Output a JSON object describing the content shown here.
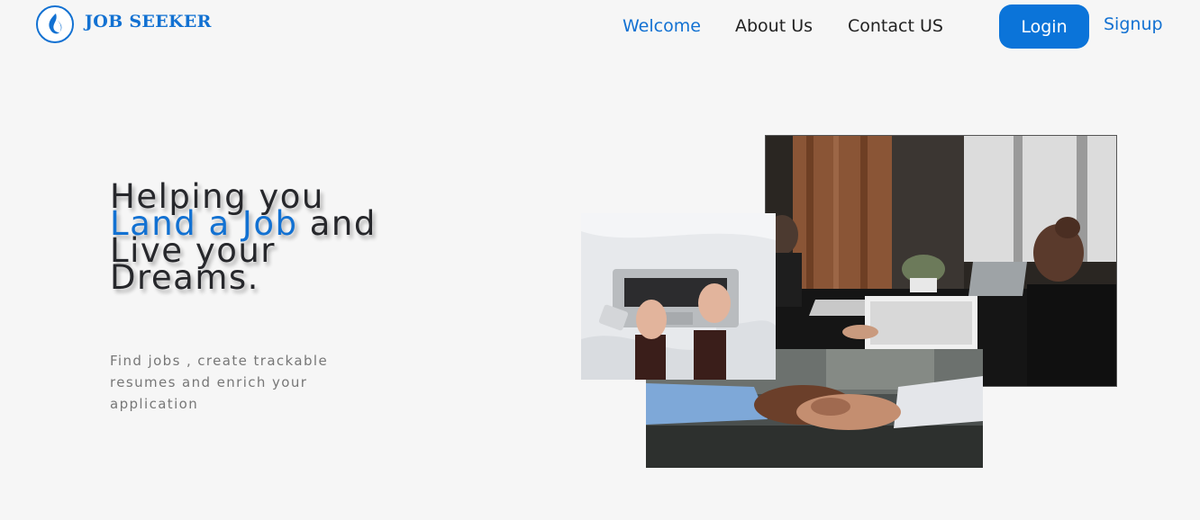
{
  "brand": {
    "name": "JOB SEEKER",
    "logo_icon": "flame-drop-icon",
    "color": "#1271d2"
  },
  "nav": {
    "welcome": "Welcome",
    "about": "About Us",
    "contact": "Contact US",
    "active": "Welcome"
  },
  "auth": {
    "login": "Login",
    "signup": "Signup",
    "login_bg": "#0b74d9"
  },
  "hero": {
    "title_line1": "Helping you",
    "title_accent": "Land a Job",
    "title_line2_rest": " and",
    "title_line3": "Live your",
    "title_line4": "Dreams.",
    "subtitle": "Find jobs , create trackable resumes and enrich your application"
  },
  "images": {
    "office": "office-meeting-photo",
    "laptop": "laptop-typing-photo",
    "handshake": "handshake-photo"
  }
}
